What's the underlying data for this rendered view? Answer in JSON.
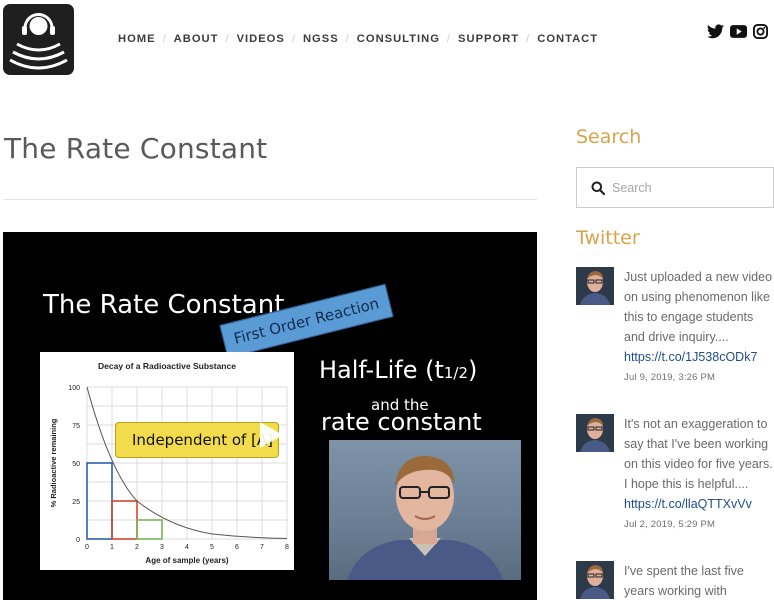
{
  "logo": {
    "icon": "headphones-sound-waves-icon"
  },
  "nav": {
    "items": [
      "HOME",
      "ABOUT",
      "VIDEOS",
      "NGSS",
      "CONSULTING",
      "SUPPORT",
      "CONTACT"
    ]
  },
  "social": {
    "icons": [
      "twitter-icon",
      "youtube-icon",
      "instagram-icon"
    ]
  },
  "page": {
    "title": "The Rate Constant"
  },
  "video": {
    "title": "The Rate Constant",
    "badge": "First Order Reaction",
    "half_life": "Half-Life (t",
    "half_life_sub": "1/2",
    "half_life_close": ")",
    "and_the": "and the",
    "rate_constant": "rate constant",
    "callout": "Independent of [A]",
    "chart": {
      "title": "Decay of a Radioactive Substance",
      "xlabel": "Age of sample (years)",
      "ylabel": "% Radioactive remaining",
      "x_ticks": [
        "0",
        "1",
        "2",
        "3",
        "4",
        "5",
        "6",
        "7",
        "8"
      ],
      "y_ticks": [
        "0",
        "25",
        "50",
        "75",
        "100"
      ]
    }
  },
  "sidebar": {
    "search_heading": "Search",
    "search_placeholder": "Search",
    "twitter_heading": "Twitter",
    "tweets": [
      {
        "text": "Just uploaded a new video on using phenomenon like this to engage students and drive inquiry....",
        "link": "https://t.co/1J538cODk7",
        "date": "Jul 9, 2019, 3:26 PM"
      },
      {
        "text": "It's not an exaggeration to say that I've been working on this video for five years. I hope this is helpful....",
        "link": "https://t.co/llaQTTXvVv",
        "date": "Jul 2, 2019, 5:29 PM"
      },
      {
        "text": "I've spent the last five years working with",
        "link": "",
        "date": ""
      }
    ]
  },
  "colors": {
    "accent": "#d9a34b",
    "link": "#1f4d8a",
    "video_bg": "#000000"
  }
}
